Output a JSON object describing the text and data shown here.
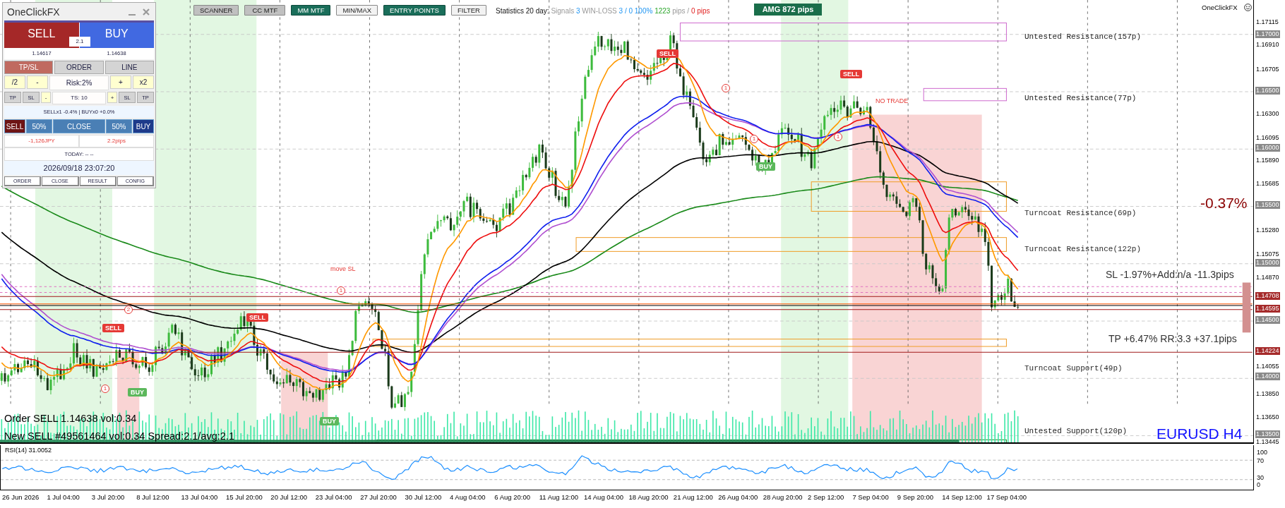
{
  "panel": {
    "title": "OneClickFX",
    "sell_button": "SELL",
    "buy_button": "BUY",
    "spread": "2.1",
    "bid": "1.14617",
    "ask": "1.14638",
    "tabs": [
      {
        "label": "TP/SL",
        "selected": true
      },
      {
        "label": "ORDER",
        "selected": false
      },
      {
        "label": "LINE",
        "selected": false
      }
    ],
    "risk_row": [
      {
        "label": "/2",
        "kind": "button"
      },
      {
        "label": "-",
        "kind": "button"
      },
      {
        "label": "Risk:2%",
        "kind": "field"
      },
      {
        "label": "+",
        "kind": "button"
      },
      {
        "label": "x2",
        "kind": "button"
      }
    ],
    "ts_row": [
      {
        "label": "TP",
        "kind": "grey"
      },
      {
        "label": "SL",
        "kind": "grey"
      },
      {
        "label": "-",
        "kind": "yellow"
      },
      {
        "label": "TS: 10",
        "kind": "field"
      },
      {
        "label": "+",
        "kind": "yellow"
      },
      {
        "label": "SL",
        "kind": "grey"
      },
      {
        "label": "TP",
        "kind": "grey"
      }
    ],
    "positions_summary": "SELLx1 -0.4% | BUYx0 +0.0%",
    "close_row": [
      {
        "label": "SELL",
        "kind": "sell"
      },
      {
        "label": "50%",
        "kind": "part"
      },
      {
        "label": "CLOSE",
        "kind": "close"
      },
      {
        "label": "50%",
        "kind": "part"
      },
      {
        "label": "BUY",
        "kind": "buy"
      }
    ],
    "profit": "-1,126JPY",
    "profit_pips": "2.2pips",
    "today": "TODAY: -- --",
    "datetime": "2026/09/18 23:07:20",
    "footer_buttons": [
      "ORDER",
      "CLOSE",
      "RESULT",
      "CONFIG"
    ]
  },
  "toolbar": [
    {
      "label": "SCANNER",
      "kind": "window"
    },
    {
      "label": "CC MTF",
      "kind": "window"
    },
    {
      "label": "MM MTF",
      "kind": "toggle",
      "on": true
    },
    {
      "label": "MIN/MAX",
      "kind": "toggle",
      "on": false
    },
    {
      "label": "ENTRY POINTS",
      "kind": "toggle",
      "on": true
    },
    {
      "label": "FILTER",
      "kind": "toggle",
      "on": false
    }
  ],
  "statistics": {
    "label": "Statistics 20 day:",
    "signals_label": "Signals",
    "signals": "3",
    "winloss_label": "WIN-LOSS",
    "winloss": "3 / 0",
    "win_rate": "100%",
    "pips_won": "1223",
    "pips_unit": "pips /",
    "pips_lost": "0 pips"
  },
  "amg_badge": "AMG 872 pips",
  "brand": "OneClickFX",
  "chart": {
    "symbol": "EURUSD H4",
    "change": "-0.37%",
    "sl_info": "SL -1.97%+Add:n/a -11.3pips",
    "tp_info": "TP +6.47% RR:3.3 +37.1pips",
    "order_info": "Order SELL 1.14638 vol:0.34",
    "new_order_info": "New SELL #49561464 vol:0.34 Spread:2.1/avg:2.1",
    "zones": [
      {
        "label": "Untested Resistance(157p)",
        "kind": "resistance"
      },
      {
        "label": "Untested Resistance(77p)",
        "kind": "resistance"
      },
      {
        "label": "Turncoat Resistance(69p)",
        "kind": "turncoat"
      },
      {
        "label": "Turncoat Resistance(122p)",
        "kind": "turncoat"
      },
      {
        "label": "Turncoat Support(49p)",
        "kind": "turncoat"
      },
      {
        "label": "Untested Support(120p)",
        "kind": "support"
      }
    ],
    "signals": [
      {
        "label": "SELL",
        "kind": "sell"
      },
      {
        "label": "SELL",
        "kind": "sell"
      },
      {
        "label": "SELL",
        "kind": "sell"
      },
      {
        "label": "SELL",
        "kind": "sell"
      },
      {
        "label": "BUY",
        "kind": "buy"
      },
      {
        "label": "BUY",
        "kind": "buy"
      },
      {
        "label": "BUY",
        "kind": "buy"
      }
    ],
    "markers": [
      "1",
      "1",
      "1",
      "1",
      "1",
      "2"
    ],
    "notes": [
      "move SL",
      "NO TRADE"
    ]
  },
  "price_axis": [
    {
      "text": "1.17115",
      "kind": "tick"
    },
    {
      "text": "1.17000",
      "kind": "grid"
    },
    {
      "text": "1.16910",
      "kind": "tick"
    },
    {
      "text": "1.16705",
      "kind": "tick"
    },
    {
      "text": "1.16500",
      "kind": "grid"
    },
    {
      "text": "1.16300",
      "kind": "tick"
    },
    {
      "text": "1.16095",
      "kind": "tick"
    },
    {
      "text": "1.16000",
      "kind": "grid"
    },
    {
      "text": "1.15890",
      "kind": "tick"
    },
    {
      "text": "1.15685",
      "kind": "tick"
    },
    {
      "text": "1.15500",
      "kind": "grid"
    },
    {
      "text": "1.15280",
      "kind": "tick"
    },
    {
      "text": "1.15075",
      "kind": "tick"
    },
    {
      "text": "1.15000",
      "kind": "grid"
    },
    {
      "text": "1.14870",
      "kind": "tick"
    },
    {
      "text": "1.14708",
      "kind": "order"
    },
    {
      "text": "1.14595",
      "kind": "order"
    },
    {
      "text": "1.14500",
      "kind": "grid"
    },
    {
      "text": "1.14224",
      "kind": "order"
    },
    {
      "text": "1.14055",
      "kind": "tick"
    },
    {
      "text": "1.14000",
      "kind": "grid"
    },
    {
      "text": "1.13850",
      "kind": "tick"
    },
    {
      "text": "1.13650",
      "kind": "tick"
    },
    {
      "text": "1.13500",
      "kind": "grid"
    },
    {
      "text": "1.13445",
      "kind": "tick"
    }
  ],
  "rsi": {
    "label": "RSI(14) 31.0052",
    "levels": [
      "100",
      "70",
      "30",
      "0"
    ]
  },
  "time_axis": [
    "26 Jun 2026",
    "1 Jul 04:00",
    "3 Jul 20:00",
    "8 Jul 12:00",
    "13 Jul 04:00",
    "15 Jul 20:00",
    "20 Jul 12:00",
    "23 Jul 04:00",
    "27 Jul 20:00",
    "30 Jul 12:00",
    "4 Aug 04:00",
    "6 Aug 20:00",
    "11 Aug 12:00",
    "14 Aug 04:00",
    "18 Aug 20:00",
    "21 Aug 12:00",
    "26 Aug 04:00",
    "28 Aug 20:00",
    "2 Sep 12:00",
    "7 Sep 04:00",
    "9 Sep 20:00",
    "14 Sep 12:00",
    "17 Sep 04:00"
  ]
}
